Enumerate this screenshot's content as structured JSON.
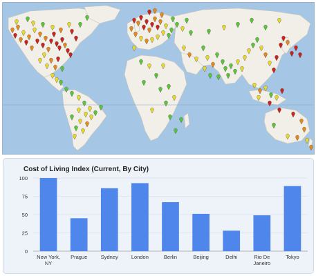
{
  "map": {
    "ocean_color": "#a6c6e6",
    "land_color": "#f1efe8",
    "marker_colors": {
      "low": "#5cc43a",
      "mid": "#e6d82c",
      "high": "#e28a1d",
      "very_high": "#c9231e"
    },
    "marker_icon": "map-pin-icon"
  },
  "chart_data": {
    "type": "bar",
    "title": "Cost of Living Index (Current, By City)",
    "xlabel": "",
    "ylabel": "",
    "categories": [
      "New York, NY",
      "Prague",
      "Sydney",
      "London",
      "Berlin",
      "Beijing",
      "Delhi",
      "Rio De Janeiro",
      "Tokyo"
    ],
    "category_lines": [
      [
        "New York,",
        "NY"
      ],
      [
        "Prague"
      ],
      [
        "Sydney"
      ],
      [
        "London"
      ],
      [
        "Berlin"
      ],
      [
        "Beijing"
      ],
      [
        "Delhi"
      ],
      [
        "Rio De",
        "Janeiro"
      ],
      [
        "Tokyo"
      ]
    ],
    "values": [
      100,
      45,
      86,
      93,
      67,
      51,
      28,
      49,
      89
    ],
    "ylim": [
      0,
      100
    ],
    "yticks": [
      0,
      25,
      50,
      75,
      100
    ],
    "grid": true,
    "bar_color": "#4e86ec",
    "legend": "none"
  }
}
